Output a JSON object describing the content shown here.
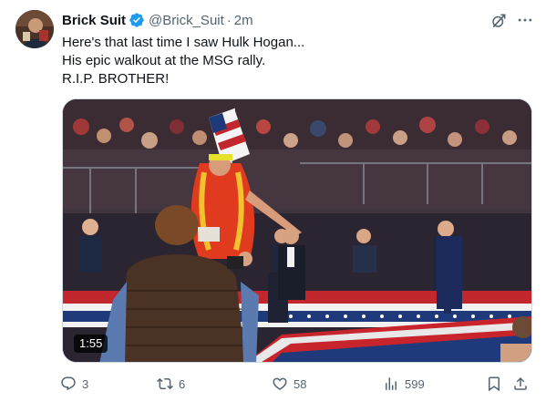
{
  "tweet": {
    "author_name": "Brick Suit",
    "handle": "@Brick_Suit",
    "separator": "·",
    "time": "2m",
    "text_lines": [
      "Here's that last time I saw Hulk Hogan...",
      "His epic walkout at the MSG rally.",
      "R.I.P. BROTHER!"
    ],
    "media": {
      "duration": "1:55"
    },
    "actions": {
      "replies": "3",
      "reposts": "6",
      "likes": "58",
      "views": "599"
    }
  },
  "icons": {
    "verified": "verified-badge-icon",
    "grok": "grok-icon",
    "more": "more-icon",
    "reply": "reply-icon",
    "repost": "repost-icon",
    "like": "heart-icon",
    "views": "views-icon",
    "bookmark": "bookmark-icon",
    "share": "share-icon"
  },
  "colors": {
    "text": "#0f1419",
    "secondary": "#536471",
    "verified": "#1d9bf0",
    "border": "#cfd9de"
  }
}
